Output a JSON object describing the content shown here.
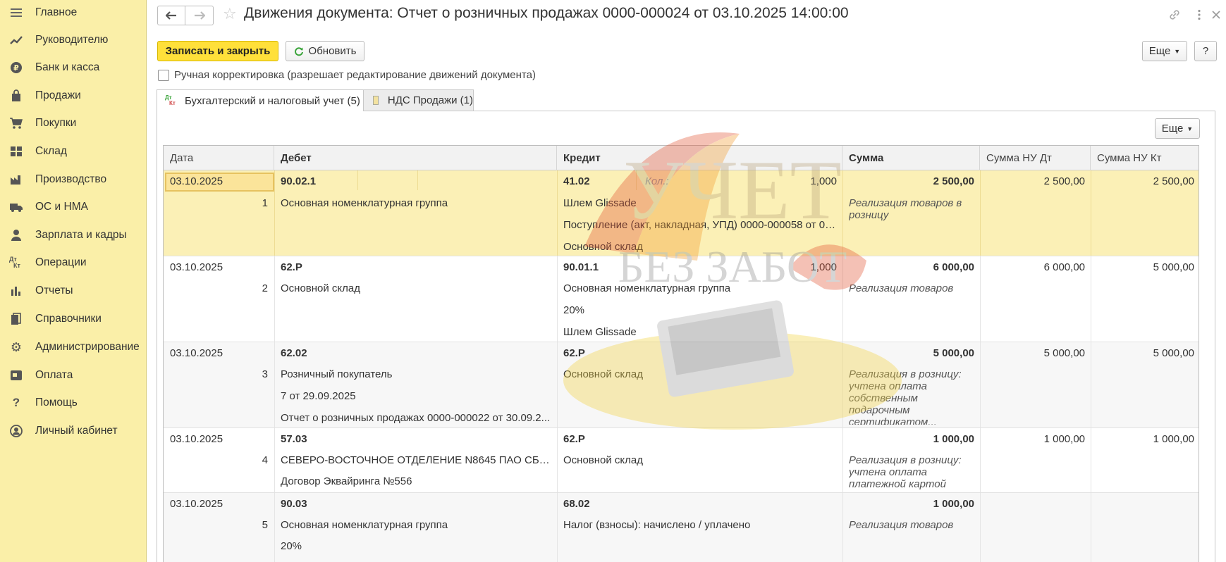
{
  "sidebar": {
    "items": [
      {
        "label": "Главное",
        "icon": "menu-icon"
      },
      {
        "label": "Руководителю",
        "icon": "trend-icon"
      },
      {
        "label": "Банк и касса",
        "icon": "coin-icon"
      },
      {
        "label": "Продажи",
        "icon": "shopping-bag-icon"
      },
      {
        "label": "Покупки",
        "icon": "cart-icon"
      },
      {
        "label": "Склад",
        "icon": "warehouse-icon"
      },
      {
        "label": "Производство",
        "icon": "factory-icon"
      },
      {
        "label": "ОС и НМА",
        "icon": "truck-icon"
      },
      {
        "label": "Зарплата и кадры",
        "icon": "person-icon"
      },
      {
        "label": "Операции",
        "icon": "dt-kt-icon"
      },
      {
        "label": "Отчеты",
        "icon": "bar-chart-icon"
      },
      {
        "label": "Справочники",
        "icon": "books-icon"
      },
      {
        "label": "Администрирование",
        "icon": "gear-icon"
      },
      {
        "label": "Оплата",
        "icon": "payment-icon"
      },
      {
        "label": "Помощь",
        "icon": "question-icon"
      },
      {
        "label": "Личный кабинет",
        "icon": "user-circle-icon"
      }
    ]
  },
  "header": {
    "title": "Движения документа: Отчет о розничных продажах 0000-000024 от 03.10.2025 14:00:00"
  },
  "toolbar": {
    "save_close_label": "Записать и закрыть",
    "refresh_label": "Обновить",
    "more_label": "Еще",
    "help_label": "?"
  },
  "manual_edit": {
    "label": "Ручная корректировка (разрешает редактирование движений документа)",
    "checked": false
  },
  "tabs": [
    {
      "label": "Бухгалтерский и налоговый учет (5)",
      "active": true
    },
    {
      "label": "НДС Продажи (1)",
      "active": false
    }
  ],
  "table_more_label": "Еще",
  "table": {
    "columns": [
      "Дата",
      "Дебет",
      "Кредит",
      "Сумма",
      "Сумма НУ Дт",
      "Сумма НУ Кт"
    ],
    "qty_label": "Кол.:",
    "rows": [
      {
        "date": "03.10.2025",
        "num": "1",
        "debit_account": "90.02.1",
        "debit_lines": [
          "Основная номенклатурная группа"
        ],
        "credit_account": "41.02",
        "credit_qty": "1,000",
        "credit_lines": [
          "Шлем Glissade",
          "Поступление (акт, накладная, УПД) 0000-000058 от 01..."
        ],
        "credit_extra": "Основной склад",
        "sum": "2 500,00",
        "note": "Реализация товаров в розницу",
        "nu_dt": "2 500,00",
        "nu_kt": "2 500,00"
      },
      {
        "date": "03.10.2025",
        "num": "2",
        "debit_account": "62.Р",
        "debit_lines": [
          "Основной склад"
        ],
        "credit_account": "90.01.1",
        "credit_qty": "1,000",
        "credit_lines": [
          "Основная номенклатурная группа",
          "20%",
          "Шлем Glissade"
        ],
        "sum": "6 000,00",
        "note": "Реализация товаров",
        "nu_dt": "6 000,00",
        "nu_kt": "5 000,00"
      },
      {
        "date": "03.10.2025",
        "num": "3",
        "debit_account": "62.02",
        "debit_lines": [
          "Розничный покупатель",
          "7 от 29.09.2025",
          "Отчет о розничных продажах 0000-000022 от 30.09.2..."
        ],
        "credit_account": "62.Р",
        "credit_lines": [
          "Основной склад"
        ],
        "sum": "5 000,00",
        "note": "Реализация в розницу: учтена оплата собственным подарочным сертификатом...",
        "nu_dt": "5 000,00",
        "nu_kt": "5 000,00"
      },
      {
        "date": "03.10.2025",
        "num": "4",
        "debit_account": "57.03",
        "debit_lines": [
          "СЕВЕРО-ВОСТОЧНОЕ ОТДЕЛЕНИЕ N8645 ПАО СБЕ...",
          "Договор Эквайринга №556"
        ],
        "credit_account": "62.Р",
        "credit_lines": [
          "Основной склад"
        ],
        "sum": "1 000,00",
        "note": "Реализация в розницу: учтена оплата платежной картой",
        "nu_dt": "1 000,00",
        "nu_kt": "1 000,00"
      },
      {
        "date": "03.10.2025",
        "num": "5",
        "debit_account": "90.03",
        "debit_lines": [
          "Основная номенклатурная группа",
          "20%"
        ],
        "credit_account": "68.02",
        "credit_lines": [
          "Налог (взносы): начислено / уплачено"
        ],
        "sum": "1 000,00",
        "note": "Реализация товаров",
        "nu_dt": "",
        "nu_kt": ""
      }
    ]
  },
  "watermark": {
    "line1": "УЧЕТ",
    "line2": "БЕЗ ЗАБОТ"
  },
  "colors": {
    "sidebar_bg": "#faefa8",
    "primary_button": "#ffe03a",
    "selected_row": "#fbf0b6"
  }
}
